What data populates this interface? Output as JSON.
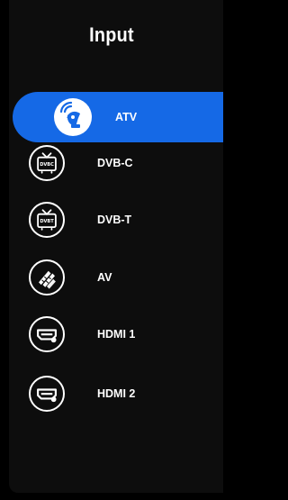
{
  "menu": {
    "title": "Input",
    "items": [
      {
        "label": "ATV",
        "icon": "antenna-dish-icon",
        "selected": true
      },
      {
        "label": "DVB-C",
        "icon": "dvbc-tv-icon",
        "icon_text": "DVBC",
        "selected": false
      },
      {
        "label": "DVB-T",
        "icon": "dvbt-tv-icon",
        "icon_text": "DVBT",
        "selected": false
      },
      {
        "label": "AV",
        "icon": "av-cable-icon",
        "selected": false
      },
      {
        "label": "HDMI 1",
        "icon": "hdmi-port-icon",
        "selected": false
      },
      {
        "label": "HDMI 2",
        "icon": "hdmi-port-icon",
        "selected": false
      }
    ]
  },
  "colors": {
    "highlight": "#1569e6",
    "background": "#0d0d0d",
    "text": "#ffffff"
  }
}
